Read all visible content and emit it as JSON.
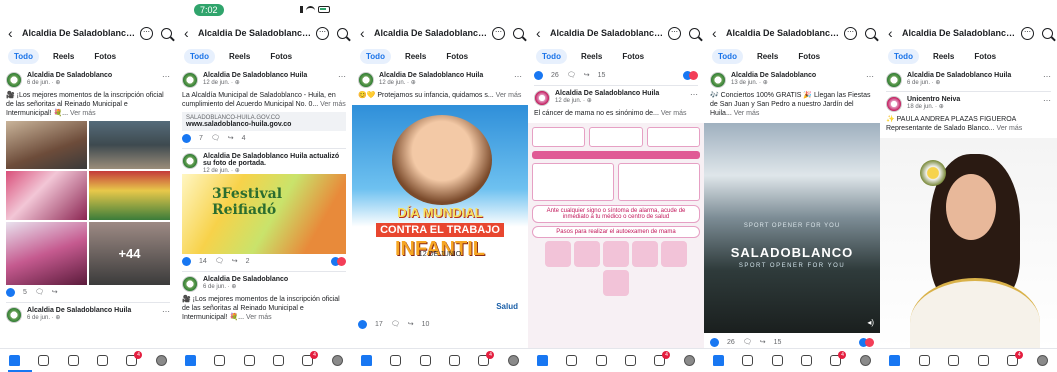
{
  "page_title": "Alcaldia De Saladoblanco H...",
  "status_time": "7:02",
  "tabs": {
    "all": "Todo",
    "reels": "Reels",
    "photos": "Fotos"
  },
  "common": {
    "more": "Ver más",
    "badge": "4"
  },
  "panel1": {
    "post1": {
      "name": "Alcaldia De Saladoblanco",
      "date": "6 de jun. · ⊕",
      "text": "🎥 ¡Los mejores momentos de la inscripción oficial de las señoritas al Reinado Municipal e Intermunicipal! 💐... "
    },
    "grid_more": "+44",
    "likes": "5",
    "post2": {
      "name": "Alcaldia De Saladoblanco Huila",
      "date": "6 de jun. · ⊕"
    }
  },
  "panel2": {
    "post1": {
      "name": "Alcaldia De Saladoblanco Huila",
      "date": "12 de jun. · ⊕",
      "text": "La Alcaldía Municipal de Saladoblanco - Huila, en cumplimiento del Acuerdo Municipal No. 0... ",
      "link_small": "SALADOBLANCO-HUILA.GOV.CO",
      "link_big": "www.saladoblanco-huila.gov.co",
      "likes": "7",
      "shares": "4"
    },
    "post2": {
      "name": "Alcaldia De Saladoblanco Huila actualizó su foto de portada.",
      "date": "12 de jun. · ⊕",
      "festival": "3Festival Reifiadó",
      "likes": "14",
      "shares": "2"
    },
    "post3": {
      "name": "Alcaldia De Saladoblanco",
      "date": "6 de jun. · ⊕",
      "text": "🎥 ¡Los mejores momentos de la inscripción oficial de las señoritas al Reinado Municipal e Intermunicipal! 💐... "
    }
  },
  "panel3": {
    "post1": {
      "name": "Alcaldia De Saladoblanco Huila",
      "date": "12 de jun. · ⊕",
      "text": "😊💛 Protejamos su infancia, quidamos s... ",
      "poster_l1": "DÍA MUNDIAL",
      "poster_l2": "CONTRA EL TRABAJO",
      "poster_l3": "INFANTIL",
      "poster_date": "12 DE JUNIO",
      "poster_footer": "Salud",
      "likes": "17",
      "shares": "10"
    }
  },
  "panel4": {
    "top_likes": "26",
    "top_shares": "15",
    "post1": {
      "name": "Alcaldia De Saladoblanco Huila",
      "date": "12 de jun. · ⊕",
      "text": "El cáncer de mama no es sinónimo de... ",
      "pill1": "Ante cualquier signo o síntoma de alarma, acude de inmediato a tu médico o centro de salud",
      "pill2": "Pasos para realizar el autoexamen de mama"
    }
  },
  "panel5": {
    "post1": {
      "name": "Alcaldia De Saladoblanco",
      "date": "13 de jun. · ⊕",
      "text": "🎶 Conciertos 100% GRATIS 🎉 Llegan las Fiestas de San Juan y San Pedro a nuestro Jardín del Huila... ",
      "sub": "SPORT OPENER FOR YOU",
      "fade": "SPORT OPENER FOR YOU",
      "title": "SALADOBLANCO",
      "likes": "26",
      "shares": "15"
    }
  },
  "panel6": {
    "post1": {
      "name": "Alcaldia De Saladoblanco Huila",
      "date": "6 de jun. · ⊕"
    },
    "post2": {
      "name": "Unicentro Neiva",
      "date": "18 de jun. · ⊕",
      "text": "✨ PAULA ANDREA PLAZAS FIGUEROA Representante de Salado Blanco... "
    }
  }
}
